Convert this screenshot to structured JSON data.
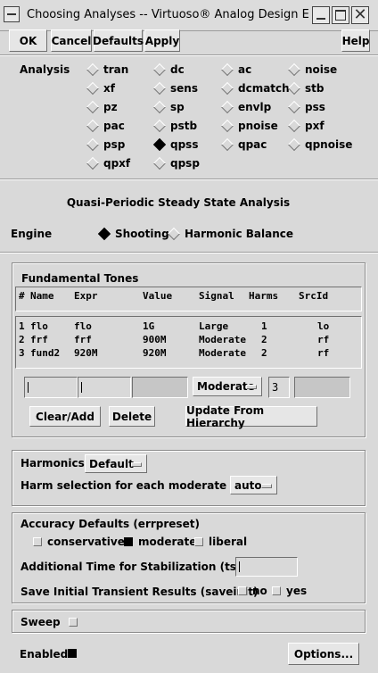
{
  "window": {
    "title": "Choosing Analyses -- Virtuoso® Analog Design Environ"
  },
  "toolbar": {
    "ok": "OK",
    "cancel": "Cancel",
    "defaults": "Defaults",
    "apply": "Apply",
    "help": "Help"
  },
  "analysis": {
    "label": "Analysis",
    "options": [
      "tran",
      "dc",
      "ac",
      "noise",
      "xf",
      "sens",
      "dcmatch",
      "stb",
      "pz",
      "sp",
      "envlp",
      "pss",
      "pac",
      "pstb",
      "pnoise",
      "pxf",
      "psp",
      "qpss",
      "qpac",
      "qpnoise",
      "qpxf",
      "qpsp"
    ],
    "selected": "qpss"
  },
  "section_title": "Quasi-Periodic Steady State Analysis",
  "engine": {
    "label": "Engine",
    "options": [
      "Shooting",
      "Harmonic Balance"
    ],
    "selected": "Shooting"
  },
  "tones": {
    "title": "Fundamental Tones",
    "headers": [
      "#",
      "Name",
      "Expr",
      "Value",
      "Signal",
      "Harms",
      "SrcId"
    ],
    "rows": [
      [
        "1",
        "flo",
        "flo",
        "1G",
        "Large",
        "1",
        "lo"
      ],
      [
        "2",
        "frf",
        "frf",
        "900M",
        "Moderate",
        "2",
        "rf"
      ],
      [
        "3",
        "fund2",
        "920M",
        "920M",
        "Moderate",
        "2",
        "rf"
      ]
    ],
    "edit": {
      "name": "",
      "expr": "",
      "value": "",
      "signal": "Moderate",
      "harms": "3",
      "srcid": ""
    },
    "buttons": {
      "clear_add": "Clear/Add",
      "delete": "Delete",
      "update": "Update From Hierarchy"
    }
  },
  "harmonics": {
    "label": "Harmonics",
    "value": "Default",
    "moderate_label": "Harm selection for each moderate tone",
    "moderate_value": "auto"
  },
  "accuracy": {
    "label": "Accuracy Defaults (errpreset)",
    "options": [
      "conservative",
      "moderate",
      "liberal"
    ],
    "selected": "moderate",
    "tstab_label": "Additional Time for Stabilization (tstab)",
    "tstab_value": "",
    "saveinit_label": "Save Initial Transient Results (saveinit)",
    "saveinit_options": [
      "no",
      "yes"
    ]
  },
  "sweep": {
    "label": "Sweep",
    "checked": false
  },
  "enabled": {
    "label": "Enabled",
    "checked": true
  },
  "options_button": "Options..."
}
